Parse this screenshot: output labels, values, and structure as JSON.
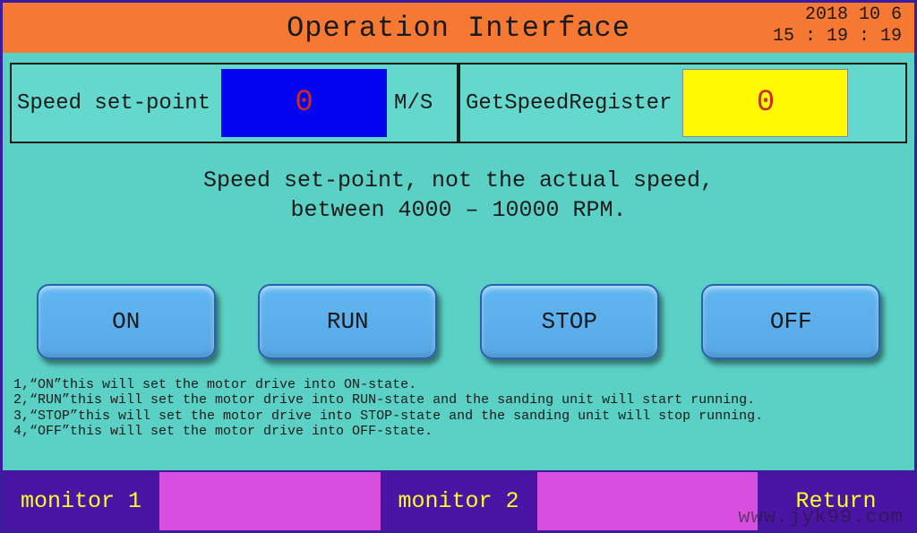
{
  "header": {
    "title": "Operation Interface",
    "date": "2018  10  6",
    "time": "15 : 19 : 19"
  },
  "panel": {
    "left": {
      "label": "Speed set-point",
      "value": "0",
      "unit": "M/S"
    },
    "right": {
      "label": "GetSpeedRegister",
      "value": "0"
    }
  },
  "description": {
    "line1": "Speed set-point, not the actual speed,",
    "line2": "between 4000 – 10000 RPM."
  },
  "buttons": {
    "on": "ON",
    "run": "RUN",
    "stop": "STOP",
    "off": "OFF"
  },
  "notes": {
    "n1": "1,“ON”this will set the motor drive into ON-state.",
    "n2": "2,“RUN”this will set the motor drive into RUN-state and the sanding unit will start running.",
    "n3": "3,“STOP”this will set the motor drive into STOP-state and the sanding unit will stop running.",
    "n4": "4,“OFF”this will set the motor drive into OFF-state."
  },
  "footer": {
    "monitor1": "monitor 1",
    "monitor2": "monitor 2",
    "return": "Return"
  },
  "watermark": "www.jyk99.com"
}
